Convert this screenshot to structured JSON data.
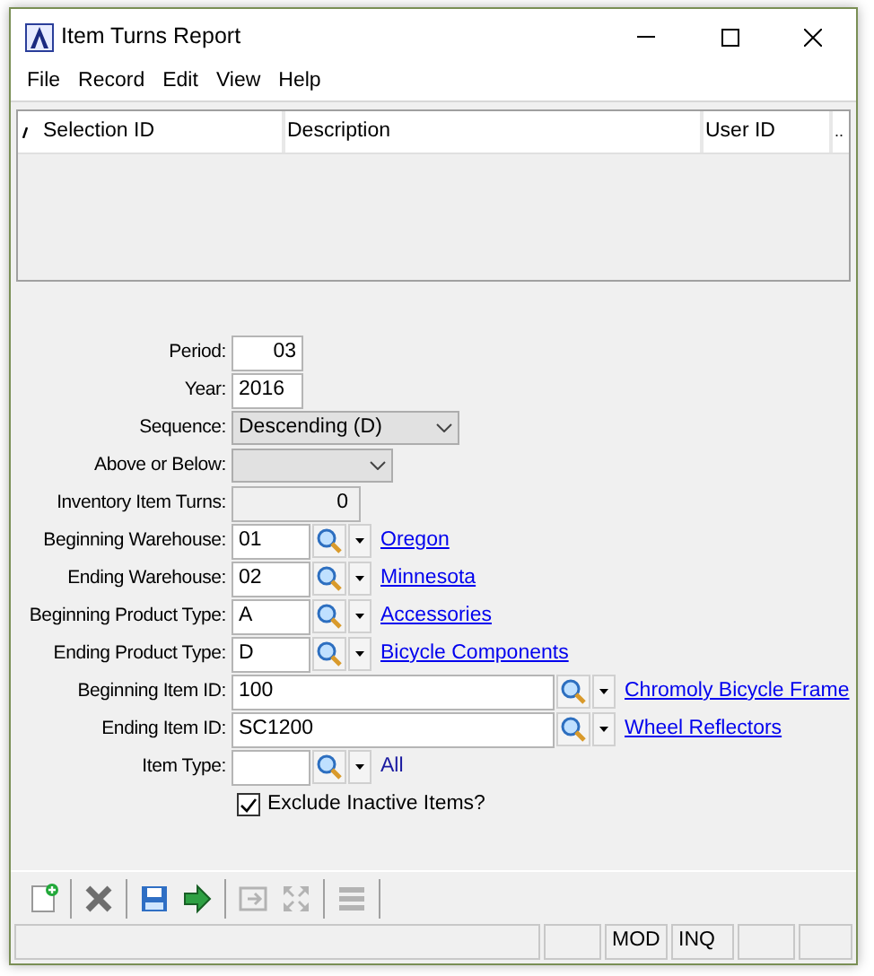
{
  "window": {
    "title": "Item Turns Report"
  },
  "menu": [
    "File",
    "Record",
    "Edit",
    "View",
    "Help"
  ],
  "grid": {
    "columns": [
      "Selection ID",
      "Description",
      "User ID",
      ".."
    ]
  },
  "fields": [
    {
      "label": "Period:",
      "kind": "number",
      "value": "03"
    },
    {
      "label": "Year:",
      "kind": "text",
      "value": "2016"
    },
    {
      "label": "Sequence:",
      "kind": "select_wide",
      "value": "Descending (D)"
    },
    {
      "label": "Above or Below:",
      "kind": "select"
    },
    {
      "label": "Inventory Item Turns:",
      "kind": "readonly",
      "value": "0"
    },
    {
      "label": "Beginning Warehouse:",
      "kind": "lookup",
      "value": "01",
      "description": "Oregon",
      "link": true
    },
    {
      "label": "Ending Warehouse:",
      "kind": "lookup",
      "value": "02",
      "description": "Minnesota",
      "link": true
    },
    {
      "label": "Beginning Product Type:",
      "kind": "lookup",
      "value": "A",
      "description": "Accessories",
      "link": true
    },
    {
      "label": "Ending Product Type:",
      "kind": "lookup",
      "value": "D",
      "description": "Bicycle Components",
      "link": true
    },
    {
      "label": "Beginning Item ID:",
      "kind": "lookup_wide",
      "value": "100",
      "description": "Chromoly Bicycle Frame",
      "link": true
    },
    {
      "label": "Ending Item ID:",
      "kind": "lookup_wide",
      "value": "SC1200",
      "description": "Wheel Reflectors",
      "link": true
    },
    {
      "label": "Item Type:",
      "kind": "lookup",
      "description": "All",
      "link": false
    },
    {
      "label": "Exclude Inactive Items?",
      "kind": "checkbox",
      "checked": true
    }
  ],
  "toolbar": [
    {
      "kind": "new",
      "disabled": false
    },
    {
      "kind": "sep"
    },
    {
      "kind": "delete",
      "disabled": false
    },
    {
      "kind": "sep"
    },
    {
      "kind": "save",
      "disabled": false
    },
    {
      "kind": "go",
      "disabled": false
    },
    {
      "kind": "sep"
    },
    {
      "kind": "import",
      "disabled": true
    },
    {
      "kind": "expand",
      "disabled": true
    },
    {
      "kind": "sep"
    },
    {
      "kind": "list",
      "disabled": true
    },
    {
      "kind": "sep"
    }
  ],
  "status_bar": [
    "MOD",
    "INQ"
  ]
}
